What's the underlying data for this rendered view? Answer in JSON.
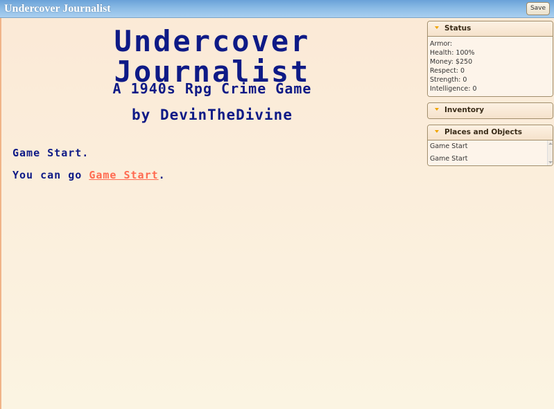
{
  "header": {
    "title": "Undercover Journalist",
    "save_label": "Save"
  },
  "main": {
    "title_line1": "Undercover",
    "title_line2": "Journalist",
    "subtitle": "A 1940s Rpg Crime Game",
    "byline": "by DevinTheDivine",
    "passage_text": "Game Start.",
    "go_prefix": "You can go ",
    "go_link": "Game Start",
    "go_suffix": "."
  },
  "sidebar": {
    "status": {
      "title": "Status",
      "lines": [
        "Armor:",
        "Health: 100%",
        "Money: $250",
        "Respect: 0",
        "Strength: 0",
        "Intelligence: 0"
      ]
    },
    "inventory": {
      "title": "Inventory"
    },
    "places": {
      "title": "Places and Objects",
      "items": [
        "Game Start",
        "Game Start"
      ]
    }
  },
  "colors": {
    "title_text": "#0e1a86",
    "link": "#ff6a50",
    "header_bar": "#8dbce6",
    "caret": "#f0a400"
  }
}
